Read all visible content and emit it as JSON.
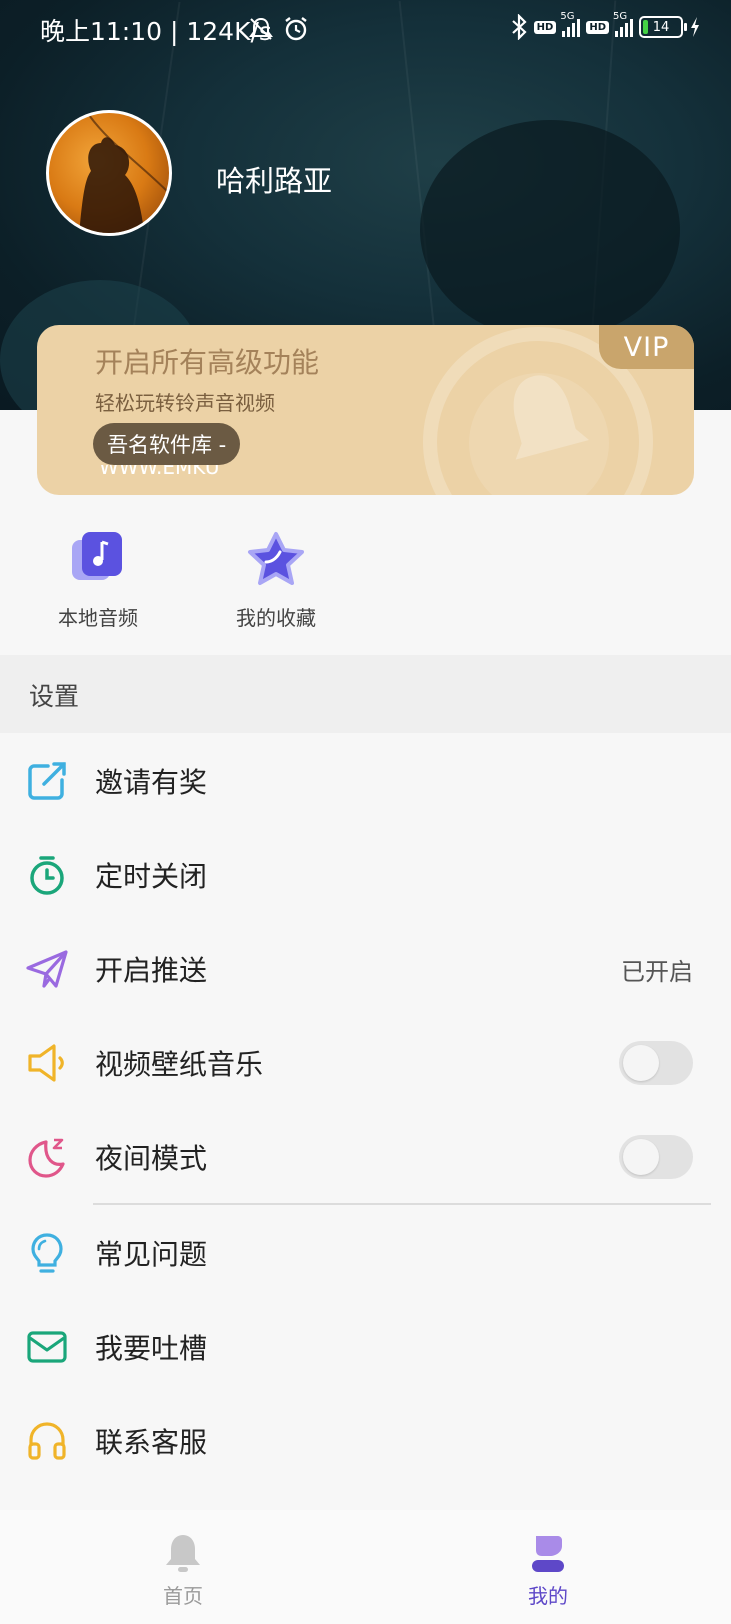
{
  "status_bar": {
    "time": "晚上11:10 | 124K/s",
    "hd_label": "HD",
    "network_label": "5G",
    "battery": "14"
  },
  "profile": {
    "username": "哈利路亚"
  },
  "vip_card": {
    "badge": "VIP",
    "title": "开启所有高级功能",
    "subtitle": "轻松玩转铃声音视频",
    "watermark_text": "吾名软件库 -",
    "watermark_overflow": "WWW.EMKU"
  },
  "shortcuts": [
    {
      "label": "本地音频",
      "icon": "music-note-icon"
    },
    {
      "label": "我的收藏",
      "icon": "star-icon"
    }
  ],
  "settings_header": "设置",
  "menu": {
    "invite": {
      "label": "邀请有奖",
      "icon": "share-icon"
    },
    "timer": {
      "label": "定时关闭",
      "icon": "timer-icon"
    },
    "push": {
      "label": "开启推送",
      "value": "已开启",
      "icon": "send-icon"
    },
    "wallpaper_music": {
      "label": "视频壁纸音乐",
      "icon": "speaker-icon",
      "on": false
    },
    "night_mode": {
      "label": "夜间模式",
      "icon": "moon-icon",
      "on": false
    },
    "faq": {
      "label": "常见问题",
      "icon": "lightbulb-icon"
    },
    "feedback": {
      "label": "我要吐槽",
      "icon": "mail-icon"
    },
    "support": {
      "label": "联系客服",
      "icon": "headset-icon"
    }
  },
  "tabbar": {
    "home": {
      "label": "首页",
      "icon": "bell-icon",
      "active": false
    },
    "mine": {
      "label": "我的",
      "icon": "person-icon",
      "active": true
    }
  },
  "colors": {
    "accent": "#6a5acd",
    "vip_card": "#ecd2a6",
    "vip_badge": "#c9a56c",
    "header_dark": "#0c1f27"
  }
}
